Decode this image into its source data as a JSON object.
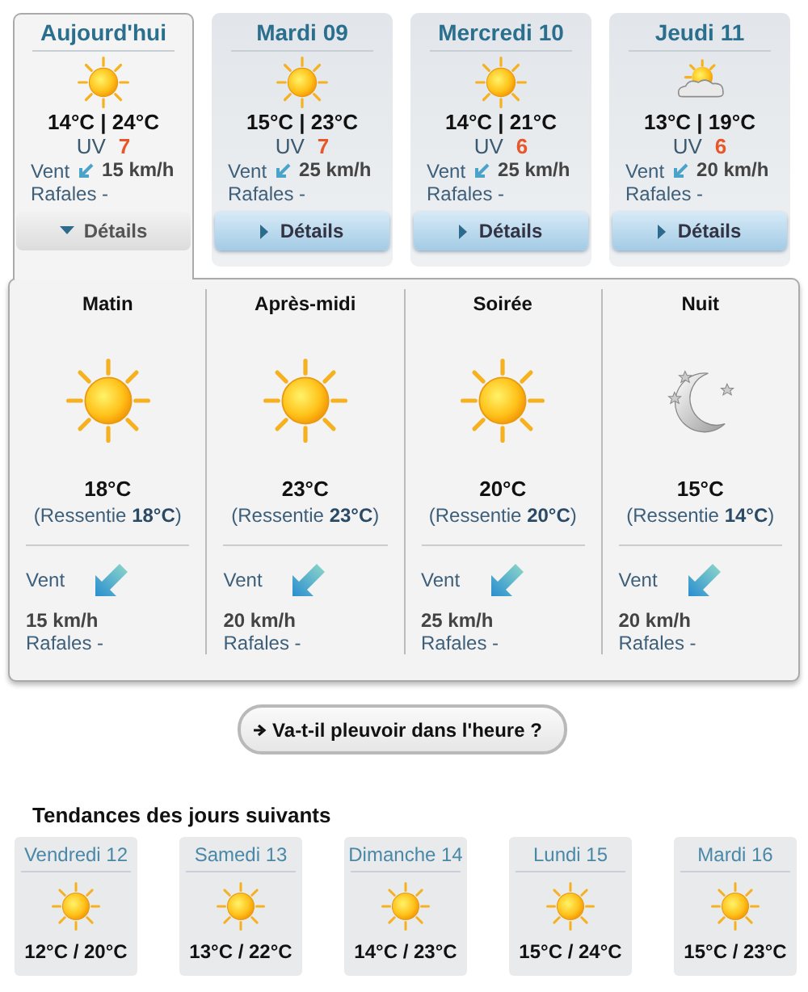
{
  "days": [
    {
      "label": "Aujourd'hui",
      "selected": true,
      "kind": "sun",
      "temps": "14°C | 24°C",
      "uv_label": "UV",
      "uv": "7",
      "wind_label": "Vent",
      "wind": "15 km/h",
      "gusts": "Rafales -",
      "details": "Détails"
    },
    {
      "label": "Mardi 09",
      "selected": false,
      "kind": "sun",
      "temps": "15°C | 23°C",
      "uv_label": "UV",
      "uv": "7",
      "wind_label": "Vent",
      "wind": "25 km/h",
      "gusts": "Rafales -",
      "details": "Détails"
    },
    {
      "label": "Mercredi 10",
      "selected": false,
      "kind": "sun",
      "temps": "14°C | 21°C",
      "uv_label": "UV",
      "uv": "6",
      "wind_label": "Vent",
      "wind": "25 km/h",
      "gusts": "Rafales -",
      "details": "Détails"
    },
    {
      "label": "Jeudi 11",
      "selected": false,
      "kind": "partly-cloudy",
      "temps": "13°C | 19°C",
      "uv_label": "UV",
      "uv": "6",
      "wind_label": "Vent",
      "wind": "20 km/h",
      "gusts": "Rafales -",
      "details": "Détails"
    }
  ],
  "periods": [
    {
      "label": "Matin",
      "kind": "sun",
      "temp": "18°C",
      "feels": "(Ressentie **18°C**)",
      "wind_label": "Vent",
      "wind": "15 km/h",
      "gusts": "Rafales -"
    },
    {
      "label": "Après-midi",
      "kind": "sun",
      "temp": "23°C",
      "feels": "(Ressentie **23°C**)",
      "wind_label": "Vent",
      "wind": "20 km/h",
      "gusts": "Rafales -"
    },
    {
      "label": "Soirée",
      "kind": "sun",
      "temp": "20°C",
      "feels": "(Ressentie **20°C**)",
      "wind_label": "Vent",
      "wind": "25 km/h",
      "gusts": "Rafales -"
    },
    {
      "label": "Nuit",
      "kind": "moon",
      "temp": "15°C",
      "feels": "(Ressentie **14°C**)",
      "wind_label": "Vent",
      "wind": "20 km/h",
      "gusts": "Rafales -"
    }
  ],
  "rain_button": {
    "label": "Va-t-il pleuvoir dans l'heure ?"
  },
  "trends": {
    "title": "Tendances des jours suivants",
    "days": [
      {
        "label": "Vendredi 12",
        "kind": "sun",
        "temps": "12°C / 20°C"
      },
      {
        "label": "Samedi 13",
        "kind": "sun",
        "temps": "13°C / 22°C"
      },
      {
        "label": "Dimanche 14",
        "kind": "sun",
        "temps": "14°C / 23°C"
      },
      {
        "label": "Lundi 15",
        "kind": "sun",
        "temps": "15°C / 24°C"
      },
      {
        "label": "Mardi 16",
        "kind": "sun",
        "temps": "15°C / 23°C"
      }
    ]
  }
}
